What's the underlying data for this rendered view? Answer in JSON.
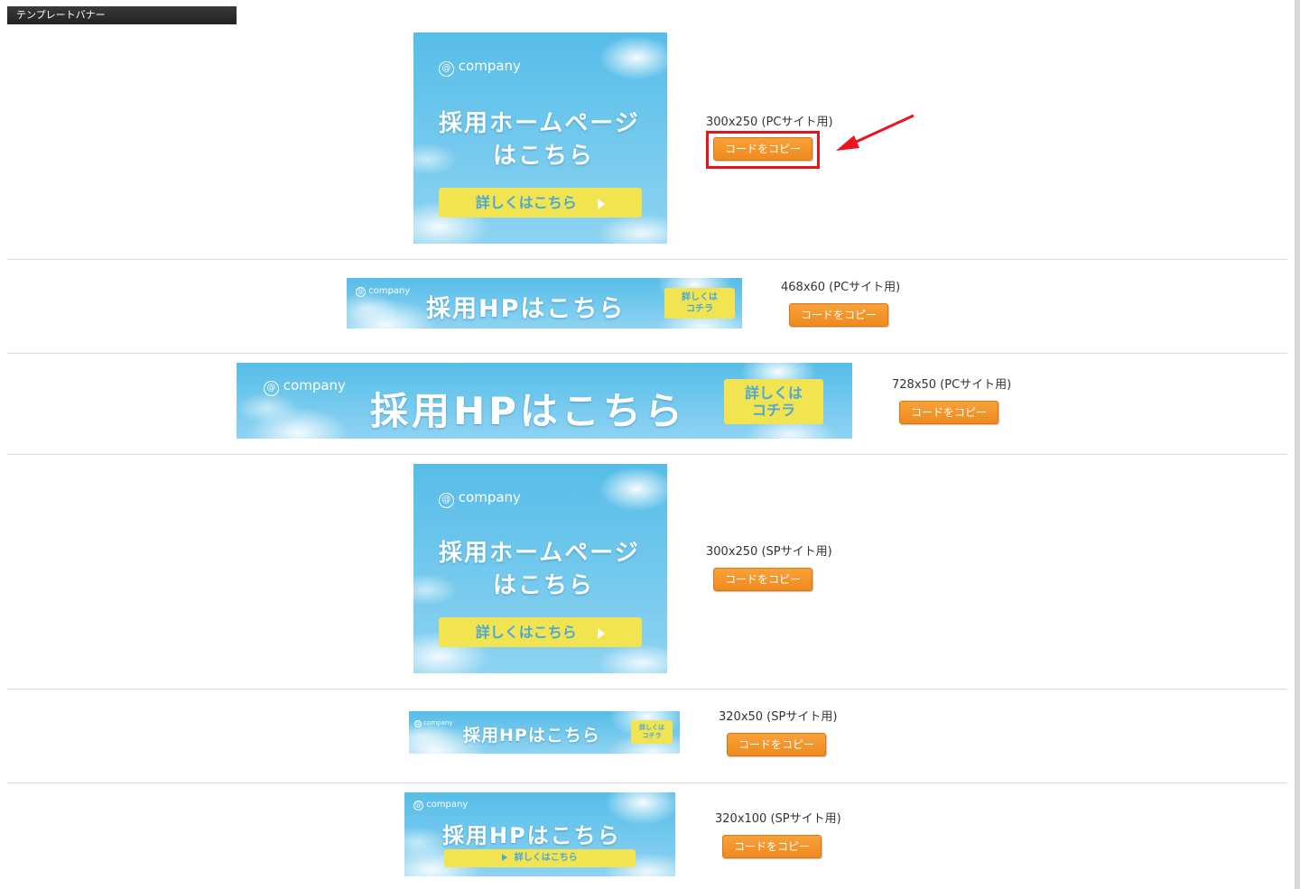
{
  "section_title": "テンプレートバナー",
  "logo_text": "company",
  "copy_label": "コードをコピー",
  "banners": [
    {
      "size_label": "300x250 (PCサイト用)",
      "headline_line1": "採用ホームページ",
      "headline_line2": "はこちら",
      "cta": "詳しくはこちら"
    },
    {
      "size_label": "468x60 (PCサイト用)",
      "headline": "採用HPはこちら",
      "cta_line1": "詳しくは",
      "cta_line2": "コチラ"
    },
    {
      "size_label": "728x50 (PCサイト用)",
      "headline": "採用HPはこちら",
      "cta_line1": "詳しくは",
      "cta_line2": "コチラ"
    },
    {
      "size_label": "300x250 (SPサイト用)",
      "headline_line1": "採用ホームページ",
      "headline_line2": "はこちら",
      "cta": "詳しくはこちら"
    },
    {
      "size_label": "320x50 (SPサイト用)",
      "headline": "採用HPはこちら",
      "cta_line1": "詳しくは",
      "cta_line2": "コチラ"
    },
    {
      "size_label": "320x100 (SPサイト用)",
      "headline": "採用HPはこちら",
      "cta": "詳しくはこちら"
    }
  ],
  "colors": {
    "accent_orange": "#f39a2e",
    "annotation_red": "#e8141e",
    "banner_sky": "#56bde8",
    "cta_yellow": "#f2e350"
  }
}
